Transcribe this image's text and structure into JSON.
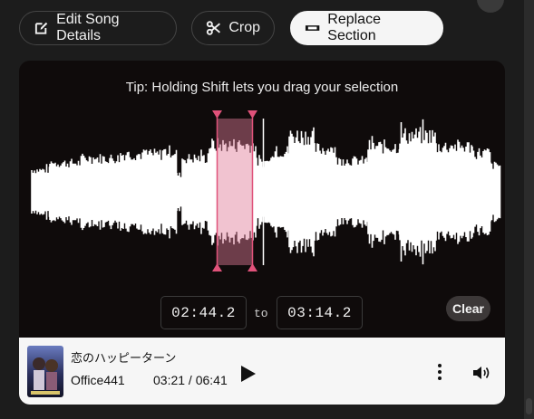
{
  "toolbar": {
    "edit_song_details": "Edit Song Details",
    "crop": "Crop",
    "replace_section": "Replace Section"
  },
  "editor": {
    "tip": "Tip: Holding Shift lets you drag your selection",
    "start_time": "02:44.2",
    "to_label": "to",
    "end_time": "03:14.2",
    "clear_label": "Clear"
  },
  "player": {
    "title": "恋のハッピーターン",
    "artist": "Office441",
    "time": "03:21 / 06:41"
  },
  "colors": {
    "selection": "#e07a97",
    "handle": "#e0527a",
    "waveform": "#ffffff",
    "panel_background": "#0f0b0b"
  }
}
